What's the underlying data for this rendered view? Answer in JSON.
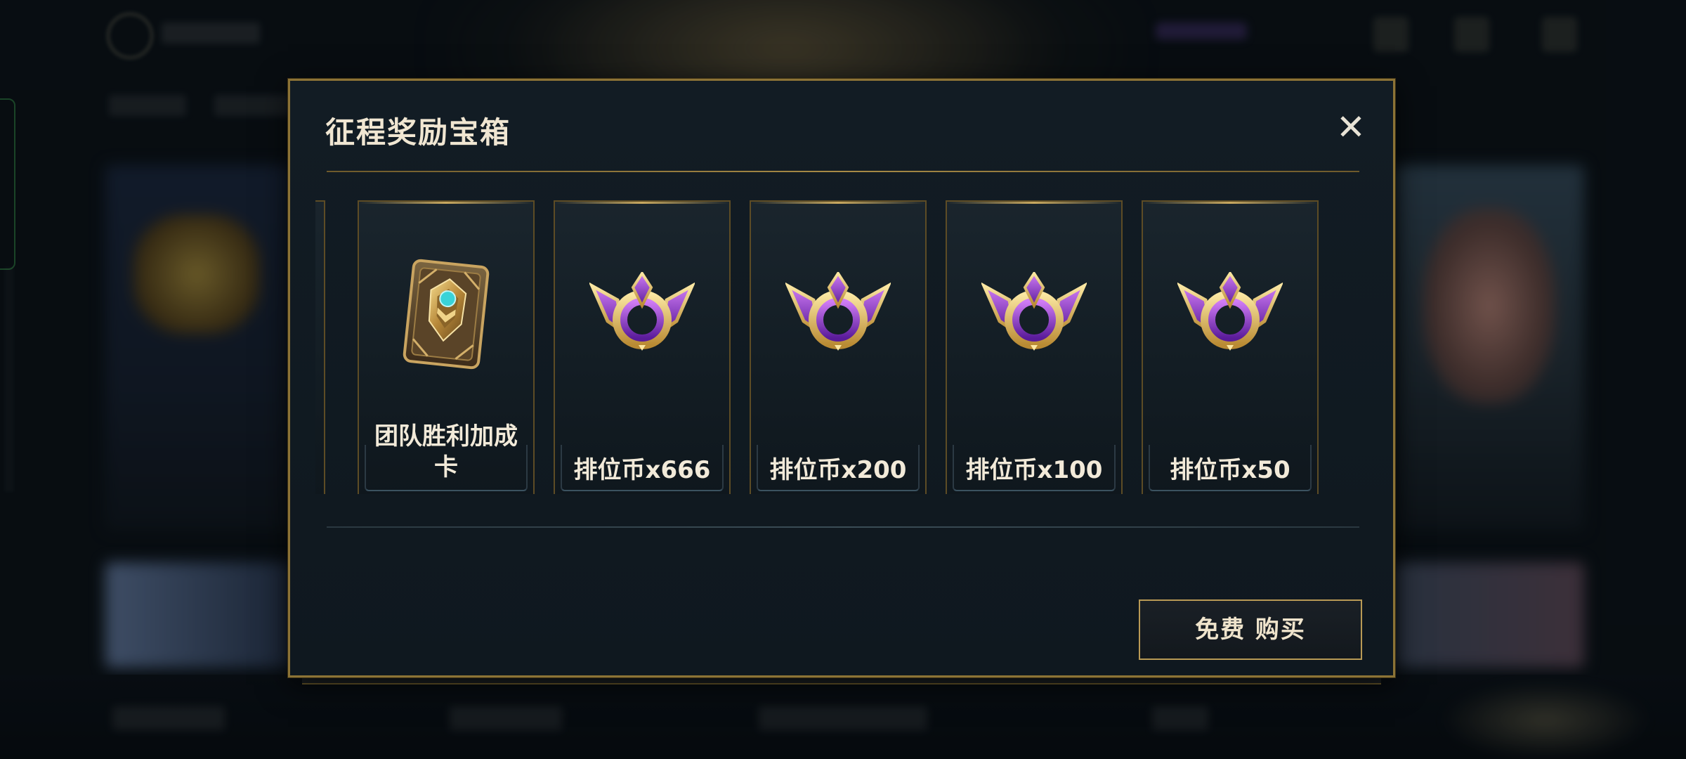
{
  "dialog": {
    "title": "征程奖励宝箱",
    "close_icon": "✕"
  },
  "rewards": [
    {
      "name": "团队胜利加成卡",
      "icon": "team-victory-boost-card-icon"
    },
    {
      "name": "排位币x666",
      "icon": "ranked-coin-emblem-icon"
    },
    {
      "name": "排位币x200",
      "icon": "ranked-coin-emblem-icon"
    },
    {
      "name": "排位币x100",
      "icon": "ranked-coin-emblem-icon"
    },
    {
      "name": "排位币x50",
      "icon": "ranked-coin-emblem-icon"
    }
  ],
  "actions": {
    "buy_label": "免费 购买"
  },
  "colors": {
    "gold_border": "#8c7336",
    "panel_bg": "#121c24",
    "text_light": "#f0e6d2",
    "emblem_purple": "#8a3cc8",
    "emblem_gold": "#d8b24a"
  }
}
